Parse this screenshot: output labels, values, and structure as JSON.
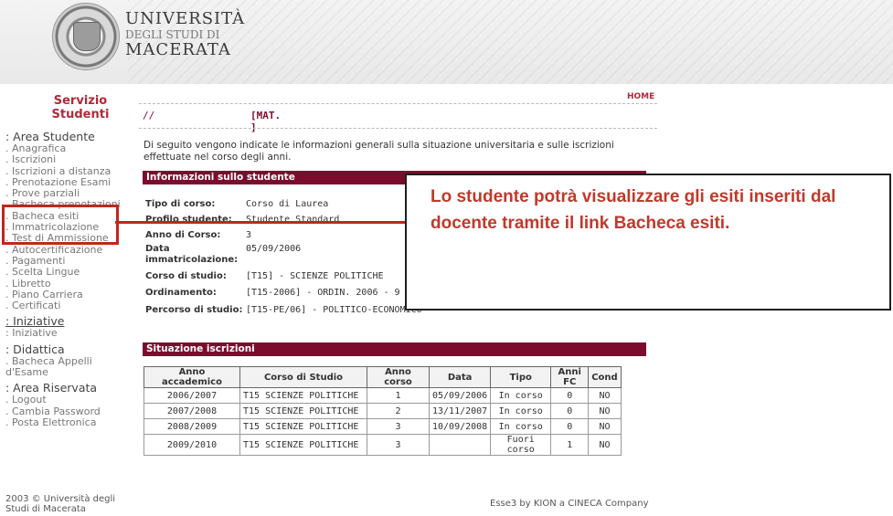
{
  "header": {
    "line1": "UNIVERSITÀ",
    "line2": "DEGLI STUDI DI",
    "line3": "MACERATA",
    "logo_icon": "university-seal-icon"
  },
  "sidebar": {
    "title_line1": "Servizio",
    "title_line2": "Studenti",
    "sections": [
      {
        "title": ": Area Studente",
        "items": [
          ". Anagrafica",
          ". Iscrizioni",
          ". Iscrizioni a distanza",
          ". Prenotazione Esami",
          ". Prove parziali",
          ". Bacheca prenotazioni",
          ". Bacheca esiti",
          ". Immatricolazione",
          ". Test di Ammissione",
          ". Autocertificazione",
          ". Pagamenti",
          ". Scelta Lingue",
          ". Libretto",
          ". Piano Carriera",
          ". Certificati"
        ]
      },
      {
        "title": ": Iniziative",
        "items": [
          ": Iniziative"
        ]
      },
      {
        "title": ": Didattica",
        "items": [
          ". Bacheca Appelli",
          "d'Esame"
        ]
      },
      {
        "title": ": Area Riservata",
        "items": [
          ". Logout",
          ". Cambia Password",
          ". Posta Elettronica"
        ]
      }
    ],
    "footer_line1": "2003 © Università degli",
    "footer_line2": "Studi di Macerata"
  },
  "top": {
    "home": "HOME",
    "crumb": "//",
    "mat": "[MAT.     ]"
  },
  "intro": "Di seguito vengono indicate le informazioni generali sulla situazione universitaria e sulle iscrizioni effettuate nel corso degli anni.",
  "info": {
    "title": "Informazioni sullo studente",
    "rows": [
      {
        "k": "Tipo di corso:",
        "v": "Corso di Laurea"
      },
      {
        "k": "Profilo studente:",
        "v": "Studente Standard"
      },
      {
        "k": "Anno di Corso:",
        "v": "3"
      },
      {
        "k": "Data immatricolazione:",
        "v": "05/09/2006"
      },
      {
        "k": "Corso di studio:",
        "v": "[T15] - SCIENZE POLITICHE"
      },
      {
        "k": "Ordinamento:",
        "v": "[T15-2006] - ORDIN. 2006 - 9"
      },
      {
        "k": "Percorso di studio:",
        "v": "[T15-PE/06] - POLITICO-ECONOMICO"
      }
    ]
  },
  "iscrizioni": {
    "title": "Situazione iscrizioni",
    "headers": [
      "Anno accademico",
      "Corso di Studio",
      "Anno corso",
      "Data",
      "Tipo",
      "Anni FC",
      "Cond"
    ],
    "rows": [
      [
        "2006/2007",
        "T15 SCIENZE POLITICHE",
        "1",
        "05/09/2006",
        "In corso",
        "0",
        "NO"
      ],
      [
        "2007/2008",
        "T15 SCIENZE POLITICHE",
        "2",
        "13/11/2007",
        "In corso",
        "0",
        "NO"
      ],
      [
        "2008/2009",
        "T15 SCIENZE POLITICHE",
        "3",
        "10/09/2008",
        "In corso",
        "0",
        "NO"
      ],
      [
        "2009/2010",
        "T15 SCIENZE POLITICHE",
        "3",
        "",
        "Fuori corso",
        "1",
        "NO"
      ]
    ]
  },
  "callout": "Lo studente potrà visualizzare gli esiti inseriti dal docente tramite il link Bacheca esiti.",
  "footer_right": "Esse3 by KION a CINECA Company",
  "colors": {
    "accent": "#7b0c2d",
    "annotation": "#c0271c",
    "title": "#b02a3a"
  }
}
